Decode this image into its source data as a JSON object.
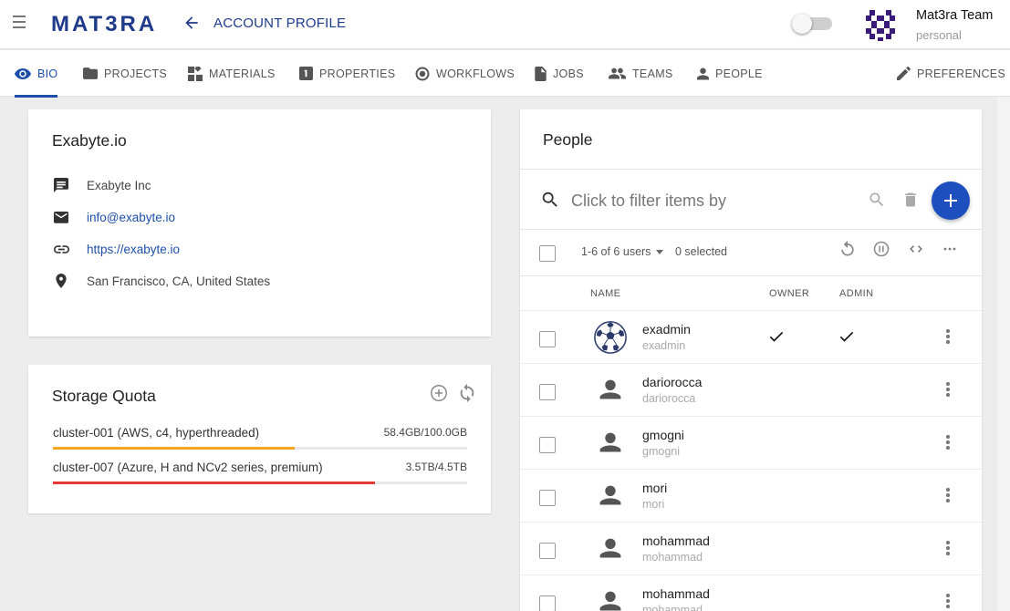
{
  "header": {
    "logo": "MAT3RA",
    "title": "ACCOUNT PROFILE",
    "account_name": "Mat3ra Team",
    "account_type": "personal",
    "icons": [
      "menu-icon",
      "arrow-left-icon",
      "toggle-switch",
      "team-avatar"
    ]
  },
  "tabs": [
    {
      "label": "BIO",
      "icon": "eye-icon",
      "active": true
    },
    {
      "label": "PROJECTS",
      "icon": "folder-icon"
    },
    {
      "label": "MATERIALS",
      "icon": "widgets-icon"
    },
    {
      "label": "PROPERTIES",
      "icon": "numbered-box-icon"
    },
    {
      "label": "WORKFLOWS",
      "icon": "radio-circle-icon"
    },
    {
      "label": "JOBS",
      "icon": "file-icon"
    },
    {
      "label": "TEAMS",
      "icon": "group-icon"
    },
    {
      "label": "PEOPLE",
      "icon": "person-icon"
    },
    {
      "label": "PREFERENCES",
      "icon": "pencil-icon"
    }
  ],
  "bio": {
    "name": "Exabyte.io",
    "company": "Exabyte Inc",
    "email": "info@exabyte.io",
    "website": "https://exabyte.io",
    "location": "San Francisco, CA, United States"
  },
  "storage": {
    "title": "Storage Quota",
    "clusters": [
      {
        "name": "cluster-001 (AWS, c4, hyperthreaded)",
        "usage": "58.4GB/100.0GB",
        "fraction": 0.584,
        "color": "#f5a623"
      },
      {
        "name": "cluster-007 (Azure, H and NCv2 series, premium)",
        "usage": "3.5TB/4.5TB",
        "fraction": 0.778,
        "color": "#e53935"
      }
    ]
  },
  "people": {
    "title": "People",
    "filter_placeholder": "Click to filter items by",
    "count_label": "1-6 of 6 users",
    "selected_label": "0 selected",
    "columns": {
      "name": "NAME",
      "owner": "OWNER",
      "admin": "ADMIN"
    },
    "users": [
      {
        "name": "exadmin",
        "login": "exadmin",
        "owner": true,
        "admin": true,
        "avatar": "soccer-ball"
      },
      {
        "name": "dariorocca",
        "login": "dariorocca",
        "owner": false,
        "admin": false,
        "avatar": "person"
      },
      {
        "name": "gmogni",
        "login": "gmogni",
        "owner": false,
        "admin": false,
        "avatar": "person"
      },
      {
        "name": "mori",
        "login": "mori",
        "owner": false,
        "admin": false,
        "avatar": "person"
      },
      {
        "name": "mohammad",
        "login": "mohammad",
        "owner": false,
        "admin": false,
        "avatar": "person"
      },
      {
        "name": "mohammad",
        "login": "mohammad",
        "owner": false,
        "admin": false,
        "avatar": "person"
      }
    ]
  },
  "colors": {
    "brand": "#1e3a8a",
    "accent": "#1e4fa8",
    "fab": "#1e4fbf"
  }
}
